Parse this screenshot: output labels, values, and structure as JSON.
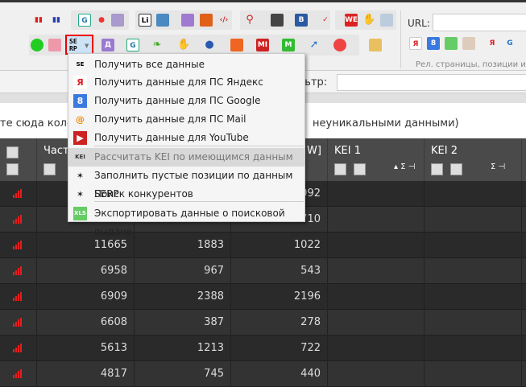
{
  "toolbar": {
    "url_label": "URL:",
    "url_value": "",
    "group_caption": "Рел. страницы, позиции и а",
    "serp_button": "SE RP"
  },
  "filterbar": {
    "label": "льтр:",
    "value": ""
  },
  "group_panel": {
    "text_left": "те сюда колон",
    "text_right": "неуникальными данными)"
  },
  "grid": {
    "headers": [
      "",
      "Част",
      "",
      "W]",
      "KEI 1",
      "KEI 2"
    ],
    "rows": [
      [
        "",
        "",
        ""
      ],
      [
        "",
        "",
        ""
      ],
      [
        "11665",
        "1883",
        "1022"
      ],
      [
        "6958",
        "967",
        "543"
      ],
      [
        "6909",
        "2388",
        "2196"
      ],
      [
        "6608",
        "387",
        "278"
      ],
      [
        "5613",
        "1213",
        "722"
      ],
      [
        "4817",
        "745",
        "440"
      ]
    ],
    "partial_col3": [
      "092",
      "710"
    ]
  },
  "menu": {
    "items": [
      {
        "label": "Получить все данные",
        "icon": "serp-icon"
      },
      {
        "label": "Получить данные для ПС Яндекс",
        "icon": "yandex-icon"
      },
      {
        "label": "Получить данные для ПС Google",
        "icon": "google-icon"
      },
      {
        "label": "Получить данные для ПС Mail",
        "icon": "mail-icon"
      },
      {
        "label": "Получить данные для YouTube",
        "icon": "youtube-icon"
      },
      {
        "label": "Рассчитать KEI по имеющимся данным",
        "icon": "kei-icon"
      },
      {
        "label": "Заполнить пустые позиции по данным SERP",
        "icon": "magic-wand-icon"
      },
      {
        "label": "Поиск конкурентов",
        "icon": "magic-wand-icon"
      },
      {
        "label": "Экспортировать данные о поисковой выдаче",
        "icon": "xls-icon"
      }
    ],
    "kei_icon_text": "KEI"
  },
  "colors": {
    "accent_red": "#e02020",
    "grid_bg": "#2b2b2b",
    "header_bg": "#4a4a4a"
  }
}
